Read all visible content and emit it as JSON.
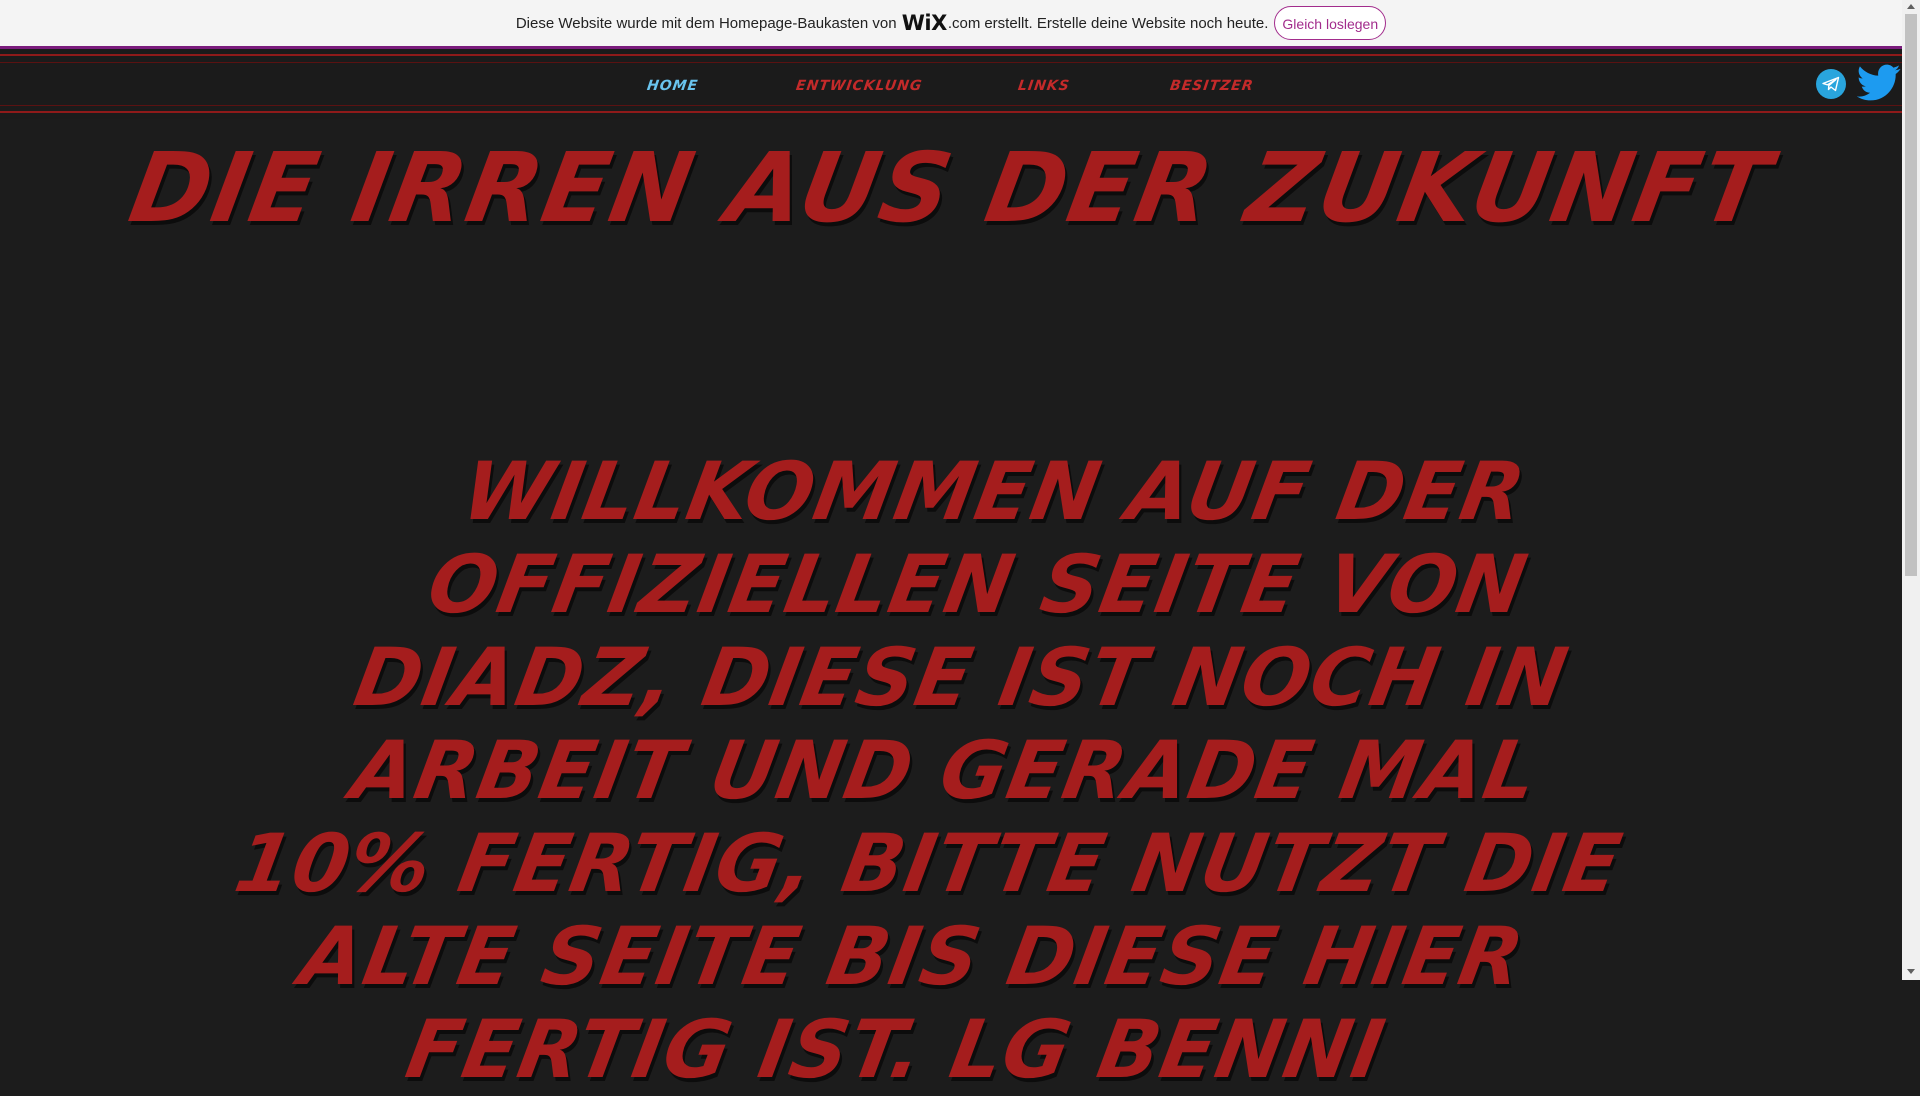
{
  "wix_banner": {
    "text_before": "Diese Website wurde mit dem Homepage-Baukasten von",
    "logo": "WiX",
    "logo_suffix": ".com",
    "text_after": "erstellt. Erstelle deine Website noch heute.",
    "button_label": "Gleich loslegen",
    "accent_color": "#a22c8c"
  },
  "nav": {
    "items": [
      {
        "label": "HOME",
        "active": true
      },
      {
        "label": "ENTWICKLUNG",
        "active": false
      },
      {
        "label": "LINKS",
        "active": false
      },
      {
        "label": "BESITZER",
        "active": false
      }
    ]
  },
  "social": {
    "icons": [
      "telegram-icon",
      "twitter-icon"
    ]
  },
  "main": {
    "title": "DIE IRREN AUS DER ZUKUNFT",
    "welcome": "WILLKOMMEN AUF DER OFFIZIELLEN SEITE VON DIADZ, DIESE IST NOCH IN ARBEIT UND GERADE MAL 10% FERTIG, BITTE NUTZT DIE ALTE SEITE BIS DIESE HIER FERTIG IST. LG BENNI"
  },
  "colors": {
    "background": "#1c1c1c",
    "heading_red": "#a51d1d",
    "nav_red": "#c42a2a",
    "nav_active": "#6ac4ee"
  }
}
